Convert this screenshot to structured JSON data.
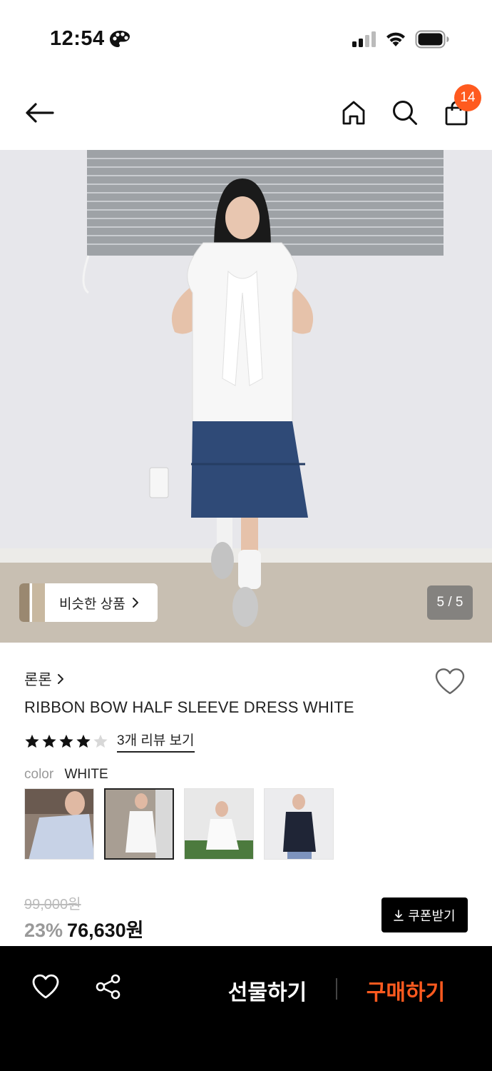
{
  "status_bar": {
    "time": "12:54"
  },
  "nav": {
    "cart_count": "14"
  },
  "hero": {
    "similar_label": "비슷한 상품",
    "page_indicator": "5 / 5"
  },
  "product": {
    "brand": "론론",
    "title": "RIBBON BOW HALF SLEEVE DRESS WHITE",
    "rating": 4,
    "rating_max": 5,
    "review_link": "3개 리뷰 보기",
    "color_label": "color",
    "color_value": "WHITE",
    "swatches": [
      {
        "icon": "light-blue-dress-thumb"
      },
      {
        "icon": "white-dress-thumb",
        "selected": true
      },
      {
        "icon": "white-dress-sitting-thumb"
      },
      {
        "icon": "navy-dress-thumb"
      }
    ],
    "original_price": "99,000원",
    "discount": "23%",
    "price": "76,630원",
    "coupon_label": "쿠폰받기"
  },
  "bottom_bar": {
    "gift_label": "선물하기",
    "buy_label": "구매하기"
  },
  "colors": {
    "accent": "#ff5a1f",
    "bar_bg": "#000000"
  }
}
